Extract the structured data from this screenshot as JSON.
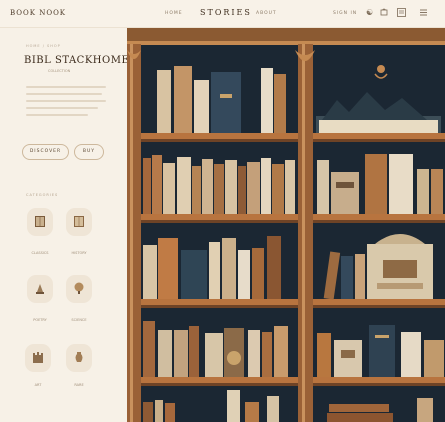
{
  "header": {
    "brand": "BOOK NOOK",
    "nav_left": "HOME",
    "title": "STORIES",
    "nav_mid": "ABOUT",
    "nav_right": "SIGN IN",
    "icons": [
      "user-icon",
      "bag-icon",
      "menu-icon"
    ]
  },
  "sidebar": {
    "breadcrumb": "HOME  /  SHOP",
    "title": "BIBL STACKHOME",
    "subtitle": "COLLECTION",
    "primary_button": "DISCOVER",
    "secondary_button": "BUY",
    "section_label": "CATEGORIES",
    "categories": [
      {
        "label": "CLASSICS",
        "icon": "book-icon"
      },
      {
        "label": "HISTORY",
        "icon": "book-icon"
      },
      {
        "label": "POETRY",
        "icon": "lamp-icon"
      },
      {
        "label": "SCIENCE",
        "icon": "globe-icon"
      },
      {
        "label": "ART",
        "icon": "castle-icon"
      },
      {
        "label": "RARE",
        "icon": "vase-icon"
      }
    ]
  },
  "colors": {
    "background": "#f6efe4",
    "shelf_wall": "#1c2a36",
    "wood": "#a3663a",
    "accent": "#c9a36b"
  }
}
